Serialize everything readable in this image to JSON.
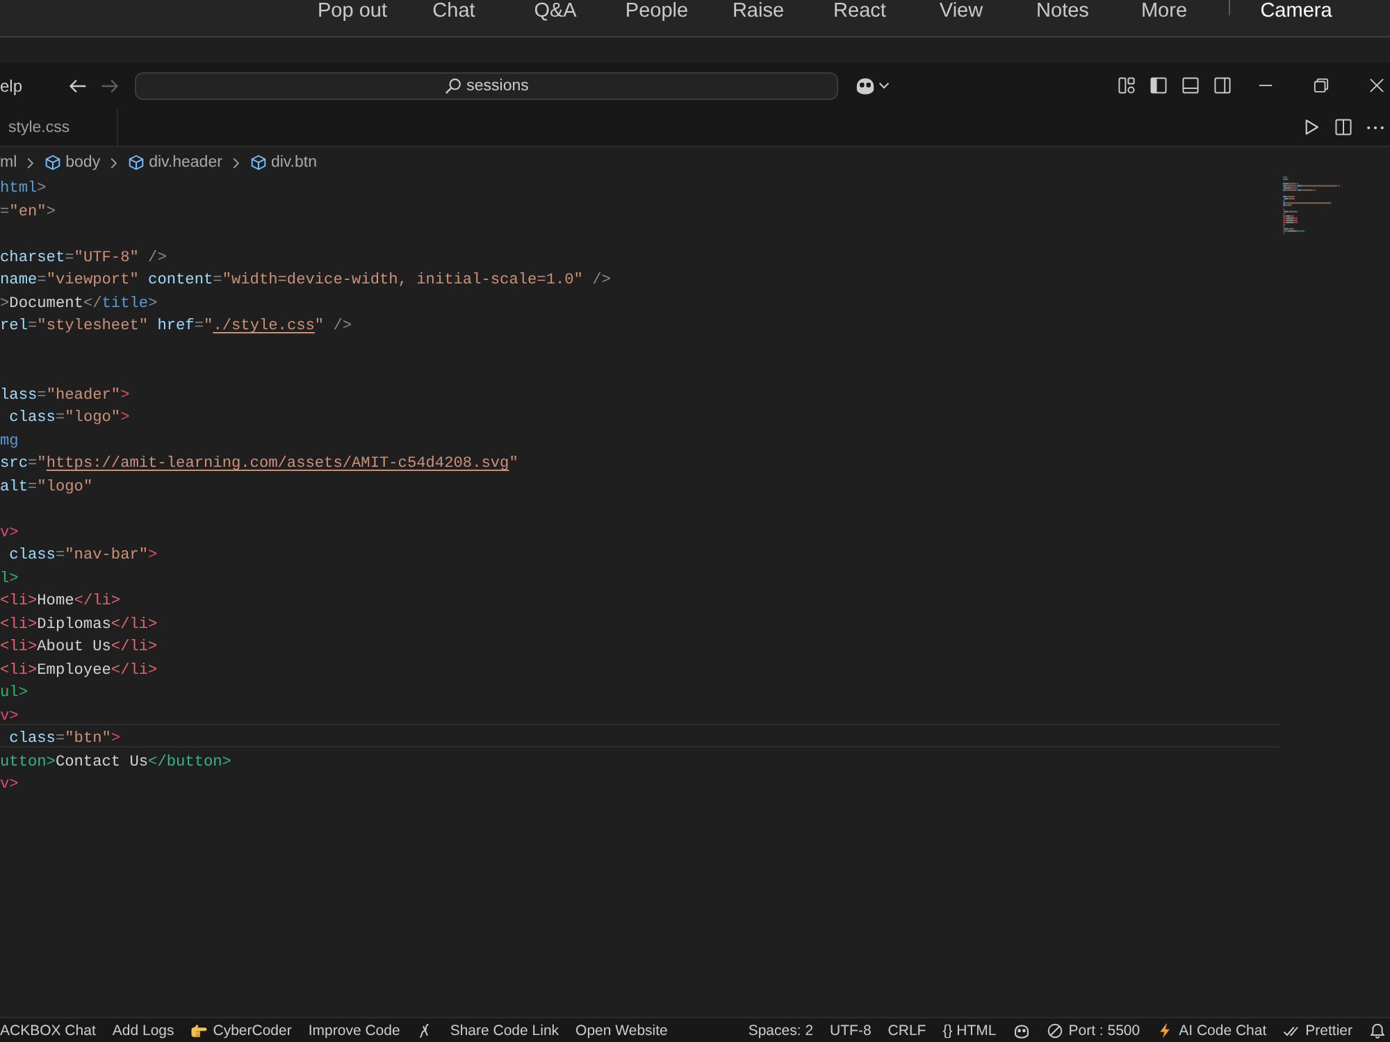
{
  "meeting_toolbar": {
    "items": [
      {
        "label": "Pop out"
      },
      {
        "label": "Chat"
      },
      {
        "label": "Q&A"
      },
      {
        "label": "People"
      },
      {
        "label": "Raise"
      },
      {
        "label": "React"
      },
      {
        "label": "View"
      },
      {
        "label": "Notes"
      },
      {
        "label": "More"
      }
    ],
    "camera": {
      "label": "Camera"
    }
  },
  "title_bar": {
    "menu": [
      "elp"
    ],
    "navigation": [
      {
        "kind": "back",
        "disabled": false
      },
      {
        "kind": "forward",
        "disabled": true
      }
    ],
    "command_center": {
      "label": "sessions"
    }
  },
  "tabs": [
    {
      "label": "style.css",
      "selected": false
    }
  ],
  "breadcrumb": [
    {
      "label": "ml",
      "kind": "file"
    },
    {
      "label": "body",
      "kind": "element"
    },
    {
      "label": "div.header",
      "kind": "element"
    },
    {
      "label": "div.btn",
      "kind": "element"
    }
  ],
  "code_lines": [
    {
      "kind": "code",
      "current": false,
      "tokens": [
        {
          "kind": "tag",
          "text": "html"
        },
        {
          "kind": "punct",
          "text": ">"
        }
      ]
    },
    {
      "kind": "code",
      "current": false,
      "tokens": [
        {
          "kind": "punct",
          "text": "="
        },
        {
          "kind": "string",
          "text": "\"en\""
        },
        {
          "kind": "punct",
          "text": ">"
        }
      ]
    },
    {
      "kind": "blank",
      "current": false
    },
    {
      "kind": "code",
      "current": false,
      "tokens": [
        {
          "kind": "attr",
          "text": "charset"
        },
        {
          "kind": "punct",
          "text": "="
        },
        {
          "kind": "string",
          "text": "\"UTF-8\""
        },
        {
          "kind": "punct",
          "text": " />"
        }
      ]
    },
    {
      "kind": "code",
      "current": false,
      "tokens": [
        {
          "kind": "attr",
          "text": "name"
        },
        {
          "kind": "punct",
          "text": "="
        },
        {
          "kind": "string",
          "text": "\"viewport\""
        },
        {
          "kind": "attr",
          "text": " content"
        },
        {
          "kind": "punct",
          "text": "="
        },
        {
          "kind": "string",
          "text": "\"width=device-width, initial-scale=1.0\""
        },
        {
          "kind": "punct",
          "text": " />"
        }
      ]
    },
    {
      "kind": "code",
      "current": false,
      "tokens": [
        {
          "kind": "punct",
          "text": ">"
        },
        {
          "kind": "text",
          "text": "Document"
        },
        {
          "kind": "punct",
          "text": "</"
        },
        {
          "kind": "tag",
          "text": "title"
        },
        {
          "kind": "punct",
          "text": ">"
        }
      ]
    },
    {
      "kind": "code",
      "current": false,
      "tokens": [
        {
          "kind": "attr",
          "text": "rel"
        },
        {
          "kind": "punct",
          "text": "="
        },
        {
          "kind": "string",
          "text": "\"stylesheet\""
        },
        {
          "kind": "attr",
          "text": " href"
        },
        {
          "kind": "punct",
          "text": "="
        },
        {
          "kind": "string",
          "text": "\""
        },
        {
          "kind": "link",
          "text": "./style.css"
        },
        {
          "kind": "string",
          "text": "\""
        },
        {
          "kind": "punct",
          "text": " />"
        }
      ]
    },
    {
      "kind": "blank",
      "current": false
    },
    {
      "kind": "blank",
      "current": false
    },
    {
      "kind": "code",
      "current": false,
      "tokens": [
        {
          "kind": "attr",
          "text": "lass"
        },
        {
          "kind": "punct",
          "text": "="
        },
        {
          "kind": "string",
          "text": "\"header\""
        },
        {
          "kind": "divtag",
          "text": ">"
        }
      ]
    },
    {
      "kind": "code",
      "current": false,
      "tokens": [
        {
          "kind": "attr",
          "text": " class"
        },
        {
          "kind": "punct",
          "text": "="
        },
        {
          "kind": "string",
          "text": "\"logo\""
        },
        {
          "kind": "divtag",
          "text": ">"
        }
      ]
    },
    {
      "kind": "code",
      "current": false,
      "tokens": [
        {
          "kind": "tag",
          "text": "mg"
        }
      ]
    },
    {
      "kind": "code",
      "current": false,
      "tokens": [
        {
          "kind": "attr",
          "text": "src"
        },
        {
          "kind": "punct",
          "text": "="
        },
        {
          "kind": "string",
          "text": "\""
        },
        {
          "kind": "link",
          "text": "https://amit-learning.com/assets/AMIT-c54d4208.svg"
        },
        {
          "kind": "string",
          "text": "\""
        }
      ]
    },
    {
      "kind": "code",
      "current": false,
      "tokens": [
        {
          "kind": "attr",
          "text": "alt"
        },
        {
          "kind": "punct",
          "text": "="
        },
        {
          "kind": "string",
          "text": "\"logo\""
        }
      ]
    },
    {
      "kind": "blank",
      "current": false
    },
    {
      "kind": "code",
      "current": false,
      "tokens": [
        {
          "kind": "divtag",
          "text": "v>"
        }
      ]
    },
    {
      "kind": "code",
      "current": false,
      "tokens": [
        {
          "kind": "attr",
          "text": " class"
        },
        {
          "kind": "punct",
          "text": "="
        },
        {
          "kind": "string",
          "text": "\"nav-bar\""
        },
        {
          "kind": "divtag",
          "text": ">"
        }
      ]
    },
    {
      "kind": "code",
      "current": false,
      "tokens": [
        {
          "kind": "listtag",
          "text": "l>"
        }
      ]
    },
    {
      "kind": "code",
      "current": false,
      "tokens": [
        {
          "kind": "itemtag",
          "text": "<li>"
        },
        {
          "kind": "text",
          "text": "Home"
        },
        {
          "kind": "itemtag",
          "text": "</li>"
        }
      ]
    },
    {
      "kind": "code",
      "current": false,
      "tokens": [
        {
          "kind": "itemtag",
          "text": "<li>"
        },
        {
          "kind": "text",
          "text": "Diplomas"
        },
        {
          "kind": "itemtag",
          "text": "</li>"
        }
      ]
    },
    {
      "kind": "code",
      "current": false,
      "tokens": [
        {
          "kind": "itemtag",
          "text": "<li>"
        },
        {
          "kind": "text",
          "text": "About Us"
        },
        {
          "kind": "itemtag",
          "text": "</li>"
        }
      ]
    },
    {
      "kind": "code",
      "current": false,
      "tokens": [
        {
          "kind": "itemtag",
          "text": "<li>"
        },
        {
          "kind": "text",
          "text": "Employee"
        },
        {
          "kind": "itemtag",
          "text": "</li>"
        }
      ]
    },
    {
      "kind": "code",
      "current": false,
      "tokens": [
        {
          "kind": "listtag",
          "text": "ul>"
        }
      ]
    },
    {
      "kind": "code",
      "current": false,
      "tokens": [
        {
          "kind": "divtag",
          "text": "v>"
        }
      ]
    },
    {
      "kind": "code",
      "current": true,
      "tokens": [
        {
          "kind": "attr",
          "text": " class"
        },
        {
          "kind": "punct",
          "text": "="
        },
        {
          "kind": "string",
          "text": "\"btn\""
        },
        {
          "kind": "divtag",
          "text": ">"
        }
      ]
    },
    {
      "kind": "code",
      "current": false,
      "tokens": [
        {
          "kind": "buttontag",
          "text": "utton>"
        },
        {
          "kind": "text",
          "text": "Contact Us"
        },
        {
          "kind": "buttontag",
          "text": "</button>"
        }
      ]
    },
    {
      "kind": "code",
      "current": false,
      "tokens": [
        {
          "kind": "divtag",
          "text": "v>"
        }
      ]
    }
  ],
  "status_bar": {
    "left": [
      {
        "kind": "text",
        "label": "ACKBOX Chat"
      },
      {
        "kind": "text",
        "label": "Add Logs"
      },
      {
        "kind": "pointer",
        "label": "CyberCoder"
      },
      {
        "kind": "text",
        "label": "Improve Code"
      },
      {
        "kind": "squiggle"
      },
      {
        "kind": "text",
        "label": "Share Code Link"
      },
      {
        "kind": "text",
        "label": "Open Website"
      }
    ],
    "right": [
      {
        "kind": "text",
        "label": "Spaces: 2"
      },
      {
        "kind": "text",
        "label": "UTF-8"
      },
      {
        "kind": "text",
        "label": "CRLF"
      },
      {
        "kind": "text",
        "label": "{} HTML"
      },
      {
        "kind": "robot"
      },
      {
        "kind": "blocked",
        "label": "Port : 5500"
      },
      {
        "kind": "bolt",
        "label": "AI Code Chat"
      },
      {
        "kind": "checks",
        "label": "Prettier"
      },
      {
        "kind": "bell"
      }
    ]
  }
}
